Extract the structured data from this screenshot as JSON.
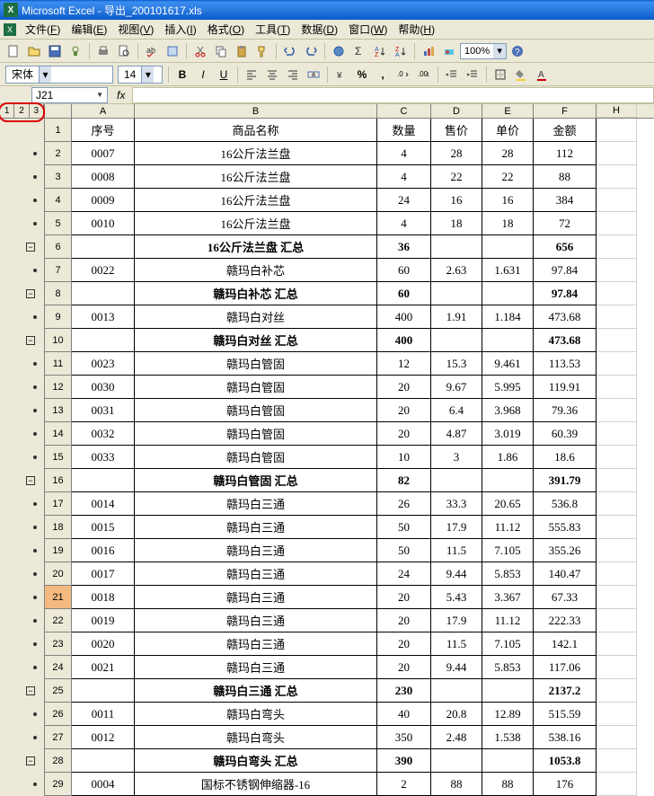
{
  "title": "Microsoft Excel - 导出_200101617.xls",
  "menu": [
    "文件(F)",
    "编辑(E)",
    "视图(V)",
    "插入(I)",
    "格式(O)",
    "工具(T)",
    "数据(D)",
    "窗口(W)",
    "帮助(H)"
  ],
  "zoom": "100%",
  "font_name": "宋体",
  "font_size": "14",
  "name_box": "J21",
  "outline_levels": [
    "1",
    "2",
    "3"
  ],
  "columns": [
    {
      "letter": "A",
      "w": "w-a"
    },
    {
      "letter": "B",
      "w": "w-b"
    },
    {
      "letter": "C",
      "w": "w-c"
    },
    {
      "letter": "D",
      "w": "w-d"
    },
    {
      "letter": "E",
      "w": "w-e"
    },
    {
      "letter": "F",
      "w": "w-f"
    },
    {
      "letter": "H",
      "w": "w-h"
    }
  ],
  "header_row": {
    "n": "1",
    "cells": [
      "序号",
      "商品名称",
      "数量",
      "售价",
      "单价",
      "金额"
    ]
  },
  "rows": [
    {
      "n": "2",
      "o": "dot",
      "a": "0007",
      "b": "16公斤法兰盘",
      "c": "4",
      "d": "28",
      "e": "28",
      "f": "112"
    },
    {
      "n": "3",
      "o": "dot",
      "a": "0008",
      "b": "16公斤法兰盘",
      "c": "4",
      "d": "22",
      "e": "22",
      "f": "88"
    },
    {
      "n": "4",
      "o": "dot",
      "a": "0009",
      "b": "16公斤法兰盘",
      "c": "24",
      "d": "16",
      "e": "16",
      "f": "384"
    },
    {
      "n": "5",
      "o": "dot",
      "a": "0010",
      "b": "16公斤法兰盘",
      "c": "4",
      "d": "18",
      "e": "18",
      "f": "72"
    },
    {
      "n": "6",
      "o": "minus",
      "bold": true,
      "a": "",
      "b": "16公斤法兰盘 汇总",
      "c": "36",
      "d": "",
      "e": "",
      "f": "656"
    },
    {
      "n": "7",
      "o": "dot",
      "a": "0022",
      "b": "赣玛白补芯",
      "c": "60",
      "d": "2.63",
      "e": "1.631",
      "f": "97.84"
    },
    {
      "n": "8",
      "o": "minus",
      "bold": true,
      "a": "",
      "b": "赣玛白补芯 汇总",
      "c": "60",
      "d": "",
      "e": "",
      "f": "97.84"
    },
    {
      "n": "9",
      "o": "dot",
      "a": "0013",
      "b": "赣玛白对丝",
      "c": "400",
      "d": "1.91",
      "e": "1.184",
      "f": "473.68"
    },
    {
      "n": "10",
      "o": "minus",
      "bold": true,
      "a": "",
      "b": "赣玛白对丝 汇总",
      "c": "400",
      "d": "",
      "e": "",
      "f": "473.68"
    },
    {
      "n": "11",
      "o": "dot",
      "a": "0023",
      "b": "赣玛白管固",
      "c": "12",
      "d": "15.3",
      "e": "9.461",
      "f": "113.53"
    },
    {
      "n": "12",
      "o": "dot",
      "a": "0030",
      "b": "赣玛白管固",
      "c": "20",
      "d": "9.67",
      "e": "5.995",
      "f": "119.91"
    },
    {
      "n": "13",
      "o": "dot",
      "a": "0031",
      "b": "赣玛白管固",
      "c": "20",
      "d": "6.4",
      "e": "3.968",
      "f": "79.36"
    },
    {
      "n": "14",
      "o": "dot",
      "a": "0032",
      "b": "赣玛白管固",
      "c": "20",
      "d": "4.87",
      "e": "3.019",
      "f": "60.39"
    },
    {
      "n": "15",
      "o": "dot",
      "a": "0033",
      "b": "赣玛白管固",
      "c": "10",
      "d": "3",
      "e": "1.86",
      "f": "18.6"
    },
    {
      "n": "16",
      "o": "minus",
      "bold": true,
      "a": "",
      "b": "赣玛白管固 汇总",
      "c": "82",
      "d": "",
      "e": "",
      "f": "391.79"
    },
    {
      "n": "17",
      "o": "dot",
      "a": "0014",
      "b": "赣玛白三通",
      "c": "26",
      "d": "33.3",
      "e": "20.65",
      "f": "536.8"
    },
    {
      "n": "18",
      "o": "dot",
      "a": "0015",
      "b": "赣玛白三通",
      "c": "50",
      "d": "17.9",
      "e": "11.12",
      "f": "555.83"
    },
    {
      "n": "19",
      "o": "dot",
      "a": "0016",
      "b": "赣玛白三通",
      "c": "50",
      "d": "11.5",
      "e": "7.105",
      "f": "355.26"
    },
    {
      "n": "20",
      "o": "dot",
      "a": "0017",
      "b": "赣玛白三通",
      "c": "24",
      "d": "9.44",
      "e": "5.853",
      "f": "140.47"
    },
    {
      "n": "21",
      "o": "dot",
      "sel": true,
      "a": "0018",
      "b": "赣玛白三通",
      "c": "20",
      "d": "5.43",
      "e": "3.367",
      "f": "67.33"
    },
    {
      "n": "22",
      "o": "dot",
      "a": "0019",
      "b": "赣玛白三通",
      "c": "20",
      "d": "17.9",
      "e": "11.12",
      "f": "222.33"
    },
    {
      "n": "23",
      "o": "dot",
      "a": "0020",
      "b": "赣玛白三通",
      "c": "20",
      "d": "11.5",
      "e": "7.105",
      "f": "142.1"
    },
    {
      "n": "24",
      "o": "dot",
      "a": "0021",
      "b": "赣玛白三通",
      "c": "20",
      "d": "9.44",
      "e": "5.853",
      "f": "117.06"
    },
    {
      "n": "25",
      "o": "minus",
      "bold": true,
      "a": "",
      "b": "赣玛白三通 汇总",
      "c": "230",
      "d": "",
      "e": "",
      "f": "2137.2"
    },
    {
      "n": "26",
      "o": "dot",
      "a": "0011",
      "b": "赣玛白弯头",
      "c": "40",
      "d": "20.8",
      "e": "12.89",
      "f": "515.59"
    },
    {
      "n": "27",
      "o": "dot",
      "a": "0012",
      "b": "赣玛白弯头",
      "c": "350",
      "d": "2.48",
      "e": "1.538",
      "f": "538.16"
    },
    {
      "n": "28",
      "o": "minus",
      "bold": true,
      "a": "",
      "b": "赣玛白弯头 汇总",
      "c": "390",
      "d": "",
      "e": "",
      "f": "1053.8"
    },
    {
      "n": "29",
      "o": "dot",
      "a": "0004",
      "b": "国标不锈钢伸缩器-16",
      "c": "2",
      "d": "88",
      "e": "88",
      "f": "176"
    }
  ]
}
